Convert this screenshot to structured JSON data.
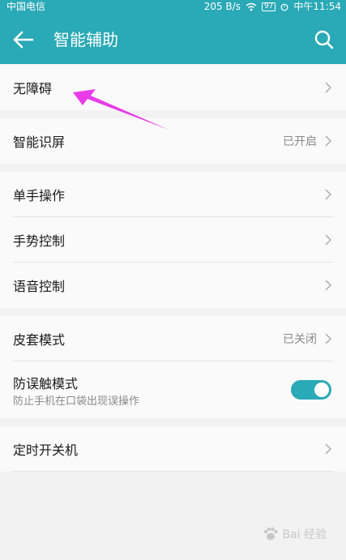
{
  "status_bar": {
    "carrier": "中国电信",
    "speed": "205 B/s",
    "battery": "97",
    "time": "中午11:54"
  },
  "app_bar": {
    "title": "智能辅助",
    "back_icon": "back-arrow-icon",
    "search_icon": "search-icon"
  },
  "settings": {
    "accessibility": {
      "label": "无障碍"
    },
    "smart_screen": {
      "label": "智能识屏",
      "value": "已开启"
    },
    "one_hand": {
      "label": "单手操作"
    },
    "gesture": {
      "label": "手势控制"
    },
    "voice": {
      "label": "语音控制"
    },
    "cover_mode": {
      "label": "皮套模式",
      "value": "已关闭"
    },
    "mistouch": {
      "label": "防误触模式",
      "sublabel": "防止手机在口袋出现误操作",
      "enabled": true
    },
    "scheduled_power": {
      "label": "定时开关机"
    }
  },
  "annotation": {
    "color": "#e83ce8"
  },
  "watermark": {
    "text": "Bai 经验"
  },
  "colors": {
    "accent": "#2aa9b6",
    "background": "#f2f2f2"
  }
}
